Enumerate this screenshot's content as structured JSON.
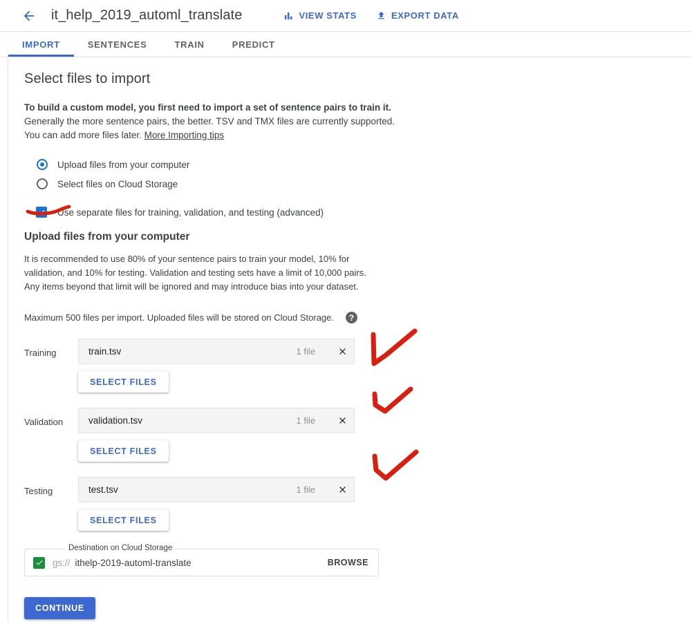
{
  "header": {
    "back_icon": "arrow-left-icon",
    "title": "it_help_2019_automl_translate",
    "actions": [
      {
        "label": "VIEW STATS",
        "icon": "bar-chart-icon"
      },
      {
        "label": "EXPORT DATA",
        "icon": "upload-icon"
      }
    ]
  },
  "tabs": [
    {
      "label": "IMPORT",
      "active": true
    },
    {
      "label": "SENTENCES",
      "active": false
    },
    {
      "label": "TRAIN",
      "active": false
    },
    {
      "label": "PREDICT",
      "active": false
    }
  ],
  "main": {
    "section_title": "Select files to import",
    "intro_strong": "To build a custom model, you first need to import a set of sentence pairs to train it.",
    "intro_line2": "Generally the more sentence pairs, the better. TSV and TMX files are currently supported.",
    "intro_line3_prefix": "You can add more files later. ",
    "intro_link": "More Importing tips",
    "source_options": [
      {
        "label": "Upload files from your computer",
        "selected": true
      },
      {
        "label": "Select files on Cloud Storage",
        "selected": false
      }
    ],
    "separate_files_checkbox": {
      "label": "Use separate files for training, validation, and testing (advanced)",
      "checked": true
    },
    "upload_title": "Upload files from your computer",
    "upload_para_line1": "It is recommended to use 80% of your sentence pairs to train your model, 10% for",
    "upload_para_line2": "validation, and 10% for testing. Validation and testing sets have a limit of 10,000 pairs.",
    "upload_para_line3": "Any items beyond that limit will be ignored and may introduce bias into your dataset.",
    "max_files_note": "Maximum 500 files per import. Uploaded files will be stored on Cloud Storage.",
    "help_icon_glyph": "?",
    "file_rows": [
      {
        "label": "Training",
        "file_name": "train.tsv",
        "count": "1 file",
        "clear_icon": "close-icon",
        "select_button": "SELECT FILES"
      },
      {
        "label": "Validation",
        "file_name": "validation.tsv",
        "count": "1 file",
        "clear_icon": "close-icon",
        "select_button": "SELECT FILES"
      },
      {
        "label": "Testing",
        "file_name": "test.tsv",
        "count": "1 file",
        "clear_icon": "close-icon",
        "select_button": "SELECT FILES"
      }
    ],
    "destination": {
      "legend": "Destination on Cloud Storage",
      "check_icon": "checkbox-checked-icon",
      "prefix": "gs://",
      "value": "ithelp-2019-automl-translate",
      "browse_label": "BROWSE"
    },
    "continue_button": "CONTINUE"
  },
  "annotations": {
    "color": "#d81f10",
    "items": [
      {
        "name": "underline-separate-files",
        "shape": "underline-stroke"
      },
      {
        "name": "checkmark-training-file",
        "shape": "check-stroke"
      },
      {
        "name": "checkmark-validation-file",
        "shape": "check-stroke"
      },
      {
        "name": "checkmark-testing-file",
        "shape": "check-stroke"
      }
    ]
  },
  "colors": {
    "accent_blue": "#3c68d0",
    "radio_blue": "#1a73d3",
    "destination_green": "#1e8e3e",
    "annotation_red": "#d81f10",
    "text_primary": "#3c4043"
  }
}
